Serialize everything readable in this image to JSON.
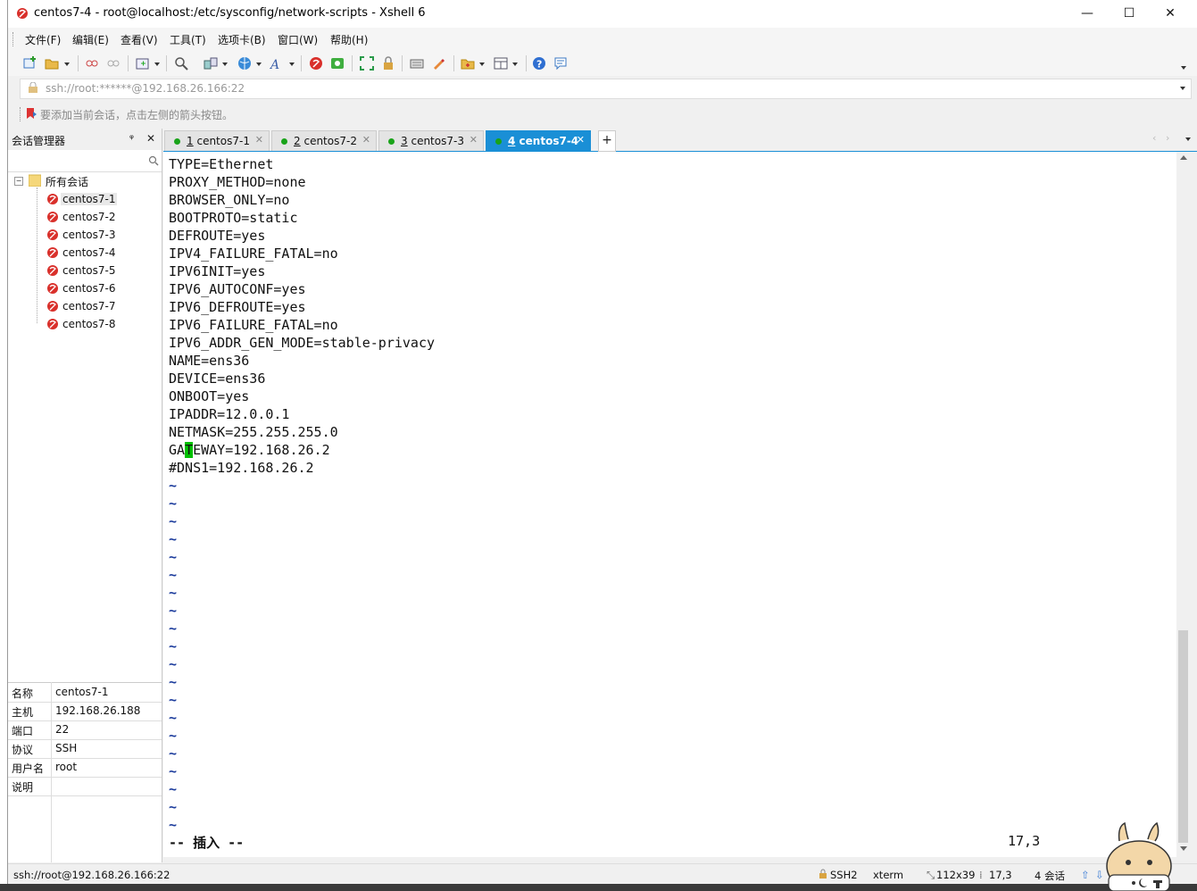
{
  "window": {
    "title": "centos7-4 - root@localhost:/etc/sysconfig/network-scripts - Xshell 6",
    "minimize": "—",
    "maximize": "☐",
    "close": "✕"
  },
  "menu": [
    "文件(F)",
    "编辑(E)",
    "查看(V)",
    "工具(T)",
    "选项卡(B)",
    "窗口(W)",
    "帮助(H)"
  ],
  "address": {
    "value": "ssh://root:******@192.168.26.166:22"
  },
  "hint": {
    "text": "要添加当前会话，点击左侧的箭头按钮。"
  },
  "session_manager": {
    "title": "会话管理器",
    "pin": "ᵠ",
    "close": "✕",
    "root": "所有会话",
    "items": [
      "centos7-1",
      "centos7-2",
      "centos7-3",
      "centos7-4",
      "centos7-5",
      "centos7-6",
      "centos7-7",
      "centos7-8"
    ],
    "selected": "centos7-1"
  },
  "properties": [
    {
      "key": "名称",
      "value": "centos7-1"
    },
    {
      "key": "主机",
      "value": "192.168.26.188"
    },
    {
      "key": "端口",
      "value": "22"
    },
    {
      "key": "协议",
      "value": "SSH"
    },
    {
      "key": "用户名",
      "value": "root"
    },
    {
      "key": "说明",
      "value": ""
    }
  ],
  "tabs": [
    {
      "num": "1",
      "label": "centos7-1",
      "active": false
    },
    {
      "num": "2",
      "label": "centos7-2",
      "active": false
    },
    {
      "num": "3",
      "label": "centos7-3",
      "active": false
    },
    {
      "num": "4",
      "label": "centos7-4",
      "active": true
    }
  ],
  "terminal": {
    "lines": [
      "TYPE=Ethernet",
      "PROXY_METHOD=none",
      "BROWSER_ONLY=no",
      "BOOTPROTO=static",
      "DEFROUTE=yes",
      "IPV4_FAILURE_FATAL=no",
      "IPV6INIT=yes",
      "IPV6_AUTOCONF=yes",
      "IPV6_DEFROUTE=yes",
      "IPV6_FAILURE_FATAL=no",
      "IPV6_ADDR_GEN_MODE=stable-privacy",
      "NAME=ens36",
      "DEVICE=ens36",
      "ONBOOT=yes",
      "IPADDR=12.0.0.1",
      "NETMASK=255.255.255.0"
    ],
    "gateway_pre": "GA",
    "gateway_cursor": "T",
    "gateway_post": "EWAY=192.168.26.2",
    "dns_line": "#DNS1=192.168.26.2",
    "tilde": "~",
    "mode": "-- 插入 --",
    "position": "17,3"
  },
  "status": {
    "connection": "ssh://root@192.168.26.166:22",
    "protocol": "SSH2",
    "term": "xterm",
    "size": "112x39",
    "cursor": "17,3",
    "sessions": "4 会话"
  }
}
